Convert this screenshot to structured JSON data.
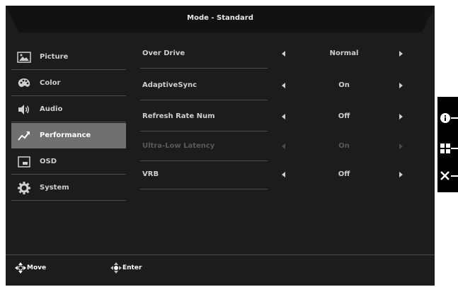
{
  "header": {
    "title": "Mode - Standard"
  },
  "sidebar": {
    "items": [
      {
        "label": "Picture",
        "icon": "picture-icon"
      },
      {
        "label": "Color",
        "icon": "palette-icon"
      },
      {
        "label": "Audio",
        "icon": "speaker-icon"
      },
      {
        "label": "Performance",
        "icon": "performance-icon"
      },
      {
        "label": "OSD",
        "icon": "osd-window-icon"
      },
      {
        "label": "System",
        "icon": "gear-icon"
      }
    ],
    "active_index": 3
  },
  "settings": [
    {
      "name": "Over Drive",
      "value": "Normal",
      "enabled": true
    },
    {
      "name": "AdaptiveSync",
      "value": "On",
      "enabled": true
    },
    {
      "name": "Refresh Rate Num",
      "value": "Off",
      "enabled": true
    },
    {
      "name": "Ultra-Low Latency",
      "value": "On",
      "enabled": false
    },
    {
      "name": "VRB",
      "value": "Off",
      "enabled": true
    }
  ],
  "footer": {
    "move_label": "Move",
    "enter_label": "Enter"
  },
  "side_buttons": [
    {
      "icon": "info-icon"
    },
    {
      "icon": "grid-icon"
    },
    {
      "icon": "close-icon"
    }
  ],
  "colors": {
    "background": "#1c1c1c",
    "active_item": "#707070",
    "text": "#cfcfcf",
    "disabled_text": "#5a5a5a"
  }
}
